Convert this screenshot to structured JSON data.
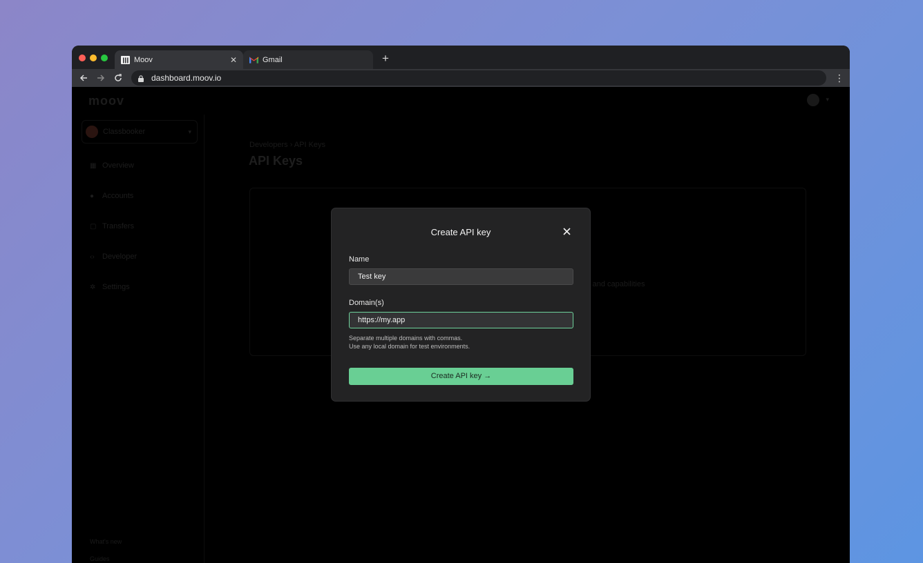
{
  "browser": {
    "tabs": [
      {
        "title": "Moov",
        "favicon": "moov-logo-icon",
        "active": true
      },
      {
        "title": "Gmail",
        "favicon": "gmail-logo-icon",
        "active": false
      }
    ],
    "tab_close": "✕",
    "new_tab": "+",
    "url": "dashboard.moov.io"
  },
  "app": {
    "logo": "moov",
    "org_name": "Classbooker",
    "nav": [
      "Overview",
      "Accounts",
      "Transfers",
      "Developer",
      "Settings"
    ],
    "footer_links": [
      "What's new",
      "Guides"
    ],
    "breadcrumb": "Developers  ›  API Keys",
    "page_title": "API Keys",
    "card_text_fragment": "ts and capabilities"
  },
  "modal": {
    "title": "Create API key",
    "name_label": "Name",
    "name_value": "Test key",
    "domain_label": "Domain(s)",
    "domain_value": "https://my.app",
    "help_line1": "Separate multiple domains with commas.",
    "help_line2": "Use any local domain for test environments.",
    "submit_label": "Create API key →"
  },
  "colors": {
    "accent": "#69cf94",
    "modal_bg": "#232324",
    "page_bg": "#000000"
  }
}
